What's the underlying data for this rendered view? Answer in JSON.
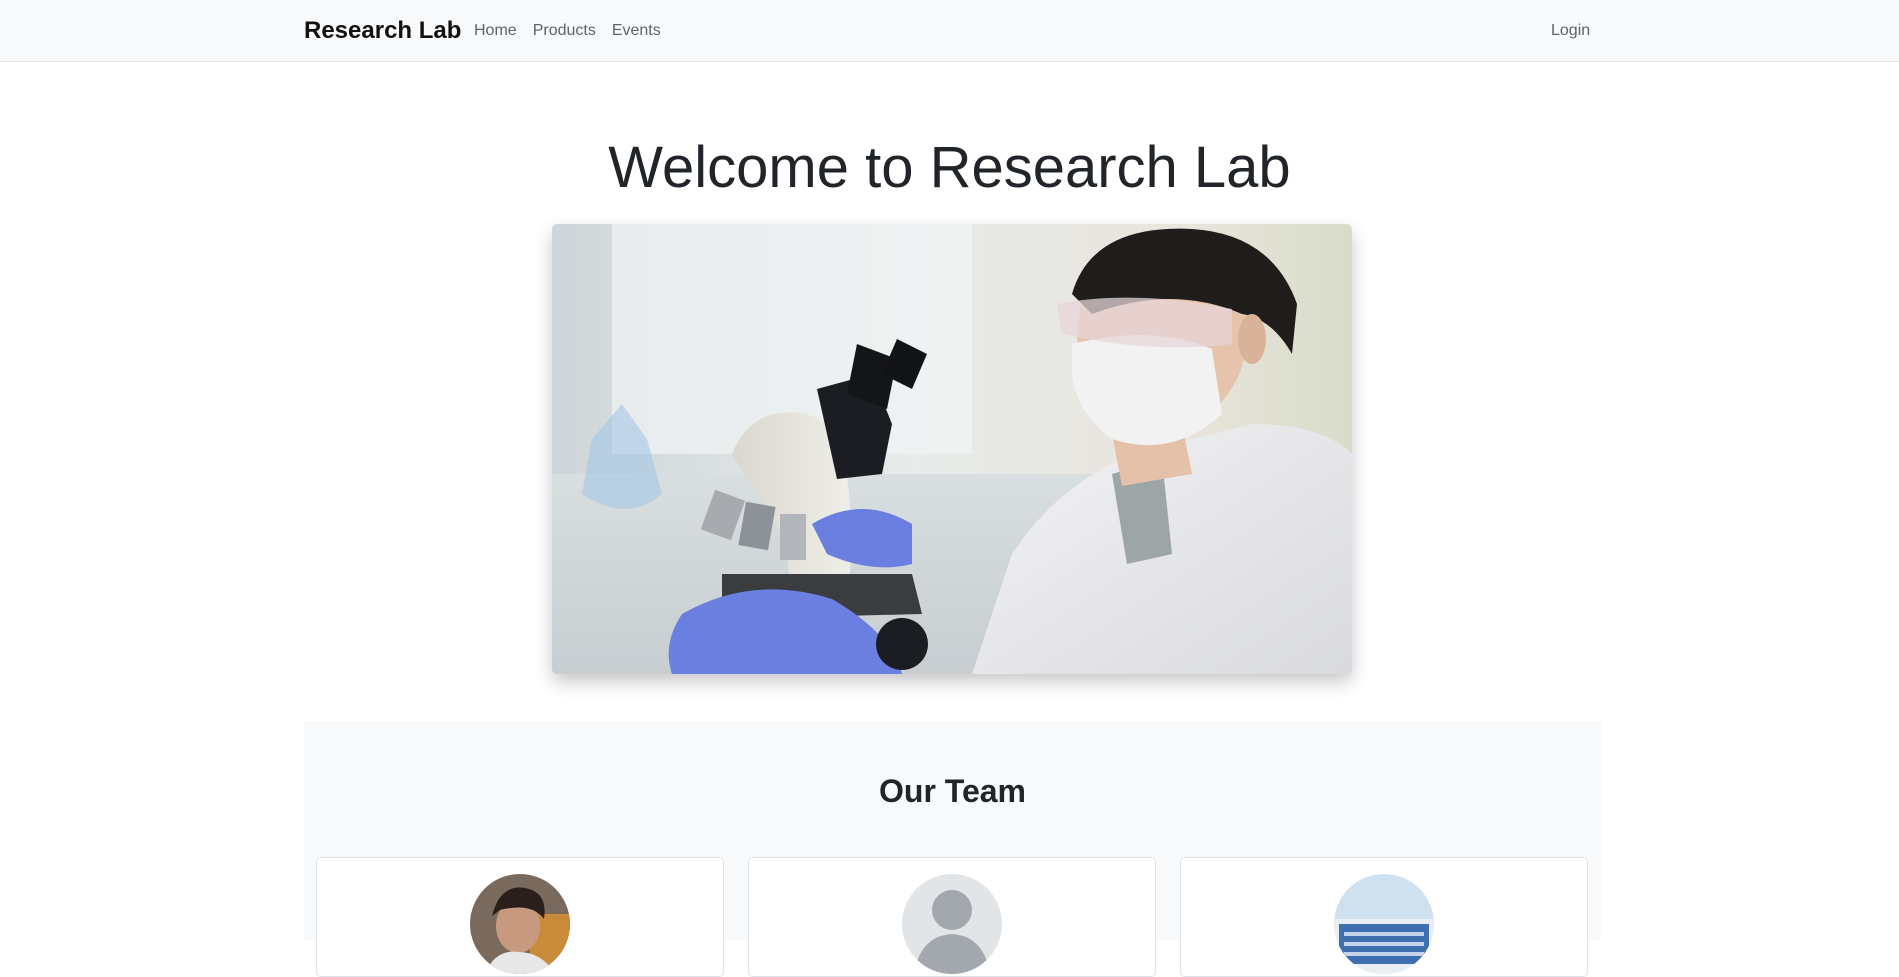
{
  "navbar": {
    "brand": "Research Lab",
    "links": [
      "Home",
      "Products",
      "Events"
    ],
    "login": "Login"
  },
  "hero": {
    "title": "Welcome to Research Lab"
  },
  "team": {
    "title": "Our Team",
    "members": [
      {
        "avatar": "person-photo"
      },
      {
        "avatar": "default-user-icon"
      },
      {
        "avatar": "building-photo"
      }
    ]
  },
  "colors": {
    "navbar_bg": "#f8f9fa",
    "section_bg": "#f8f9fa",
    "link": "#5f6368",
    "glove_blue": "#6b7fe0"
  }
}
